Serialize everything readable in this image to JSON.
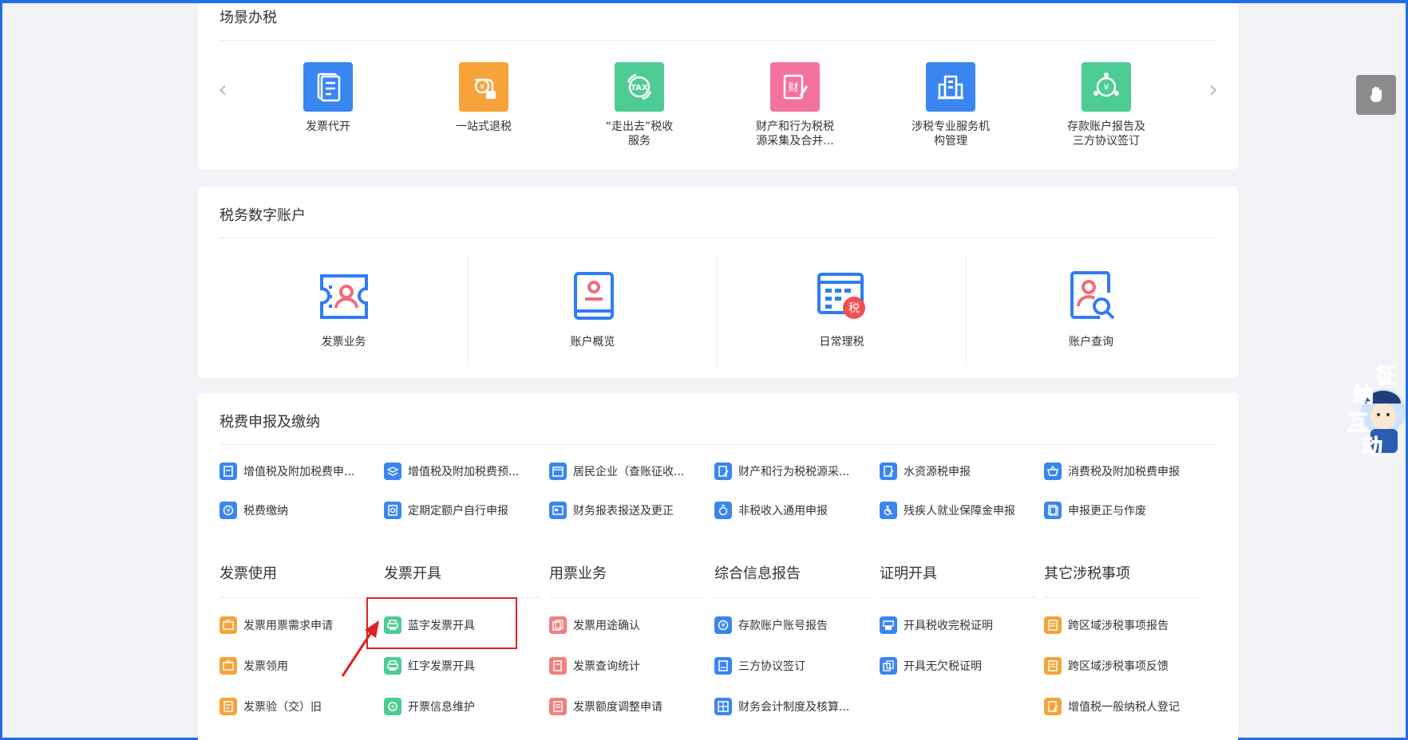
{
  "scene": {
    "title": "场景办税",
    "prev_arrow": "‹",
    "next_arrow": "›",
    "items": [
      {
        "label": "发票代开",
        "color": "#3a86f0",
        "icon": "invoice-icon"
      },
      {
        "label": "一站式退税",
        "color": "#f7a33a",
        "icon": "refund-icon"
      },
      {
        "label": "“走出去”税收\n服务",
        "color": "#4dcc93",
        "icon": "tax-globe-icon"
      },
      {
        "label": "财产和行为税税\n源采集及合并...",
        "color": "#f372a0",
        "icon": "property-tax-icon"
      },
      {
        "label": "涉税专业服务机\n构管理",
        "color": "#3a86f0",
        "icon": "building-icon"
      },
      {
        "label": "存款账户报告及\n三方协议签订",
        "color": "#4dcc93",
        "icon": "deposit-icon"
      }
    ]
  },
  "digital": {
    "title": "税务数字账户",
    "items": [
      {
        "label": "发票业务",
        "icon": "invoice-business-icon"
      },
      {
        "label": "账户概览",
        "icon": "account-overview-icon"
      },
      {
        "label": "日常理税",
        "icon": "daily-tax-icon",
        "badge": "税"
      },
      {
        "label": "账户查询",
        "icon": "account-query-icon"
      }
    ]
  },
  "filing": {
    "title": "税费申报及缴纳",
    "links": [
      {
        "label": "增值税及附加税费申...",
        "color": "#3a86f0"
      },
      {
        "label": "增值税及附加税费预...",
        "color": "#3a86f0"
      },
      {
        "label": "居民企业（查账征收...",
        "color": "#3a86f0"
      },
      {
        "label": "财产和行为税税源采...",
        "color": "#3a86f0"
      },
      {
        "label": "水资源税申报",
        "color": "#3a86f0"
      },
      {
        "label": "消费税及附加税费申报",
        "color": "#3a86f0"
      },
      {
        "label": "税费缴纳",
        "color": "#3a86f0"
      },
      {
        "label": "定期定额户自行申报",
        "color": "#3a86f0"
      },
      {
        "label": "财务报表报送及更正",
        "color": "#3a86f0"
      },
      {
        "label": "非税收入通用申报",
        "color": "#3a86f0"
      },
      {
        "label": "残疾人就业保障金申报",
        "color": "#3a86f0"
      },
      {
        "label": "申报更正与作废",
        "color": "#3a86f0"
      }
    ],
    "categories": [
      {
        "title": "发票使用",
        "items": [
          {
            "label": "发票用票需求申请",
            "color": "#f7a33a"
          },
          {
            "label": "发票领用",
            "color": "#f7a33a"
          },
          {
            "label": "发票验（交）旧",
            "color": "#f7a33a"
          }
        ]
      },
      {
        "title": "发票开具",
        "items": [
          {
            "label": "蓝字发票开具",
            "color": "#4dcc93"
          },
          {
            "label": "红字发票开具",
            "color": "#4dcc93"
          },
          {
            "label": "开票信息维护",
            "color": "#4dcc93"
          }
        ]
      },
      {
        "title": "用票业务",
        "items": [
          {
            "label": "发票用途确认",
            "color": "#f47e7e"
          },
          {
            "label": "发票查询统计",
            "color": "#f47e7e"
          },
          {
            "label": "发票额度调整申请",
            "color": "#f47e7e"
          }
        ]
      },
      {
        "title": "综合信息报告",
        "items": [
          {
            "label": "存款账户账号报告",
            "color": "#3a86f0"
          },
          {
            "label": "三方协议签订",
            "color": "#3a86f0"
          },
          {
            "label": "财务会计制度及核算...",
            "color": "#3a86f0"
          }
        ]
      },
      {
        "title": "证明开具",
        "items": [
          {
            "label": "开具税收完税证明",
            "color": "#3a86f0"
          },
          {
            "label": "开具无欠税证明",
            "color": "#3a86f0"
          }
        ]
      },
      {
        "title": "其它涉税事项",
        "items": [
          {
            "label": "跨区域涉税事项报告",
            "color": "#f7a33a"
          },
          {
            "label": "跨区域涉税事项反馈",
            "color": "#f7a33a"
          },
          {
            "label": "增值税一般纳税人登记",
            "color": "#f7a33a"
          }
        ]
      }
    ]
  },
  "mascot": {
    "line1": "征",
    "line2": "纳",
    "line3": "互",
    "line4": "动"
  }
}
